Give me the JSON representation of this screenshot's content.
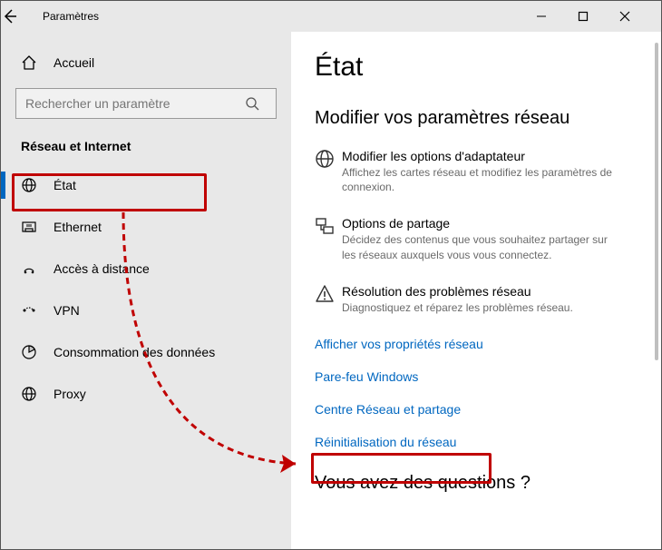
{
  "titlebar": {
    "title": "Paramètres"
  },
  "sidebar": {
    "home_label": "Accueil",
    "search_placeholder": "Rechercher un paramètre",
    "category_label": "Réseau et Internet",
    "items": [
      {
        "label": "État"
      },
      {
        "label": "Ethernet"
      },
      {
        "label": "Accès à distance"
      },
      {
        "label": "VPN"
      },
      {
        "label": "Consommation des données"
      },
      {
        "label": "Proxy"
      }
    ]
  },
  "main": {
    "heading": "État",
    "section_heading": "Modifier vos paramètres réseau",
    "settings": [
      {
        "title": "Modifier les options d'adaptateur",
        "desc": "Affichez les cartes réseau et modifiez les paramètres de connexion."
      },
      {
        "title": "Options de partage",
        "desc": "Décidez des contenus que vous souhaitez partager sur les réseaux auxquels vous vous connectez."
      },
      {
        "title": "Résolution des problèmes réseau",
        "desc": "Diagnostiquez et réparez les problèmes réseau."
      }
    ],
    "links": [
      "Afficher vos propriétés réseau",
      "Pare-feu Windows",
      "Centre Réseau et partage",
      "Réinitialisation du réseau"
    ],
    "help_heading": "Vous avez des questions ?"
  }
}
